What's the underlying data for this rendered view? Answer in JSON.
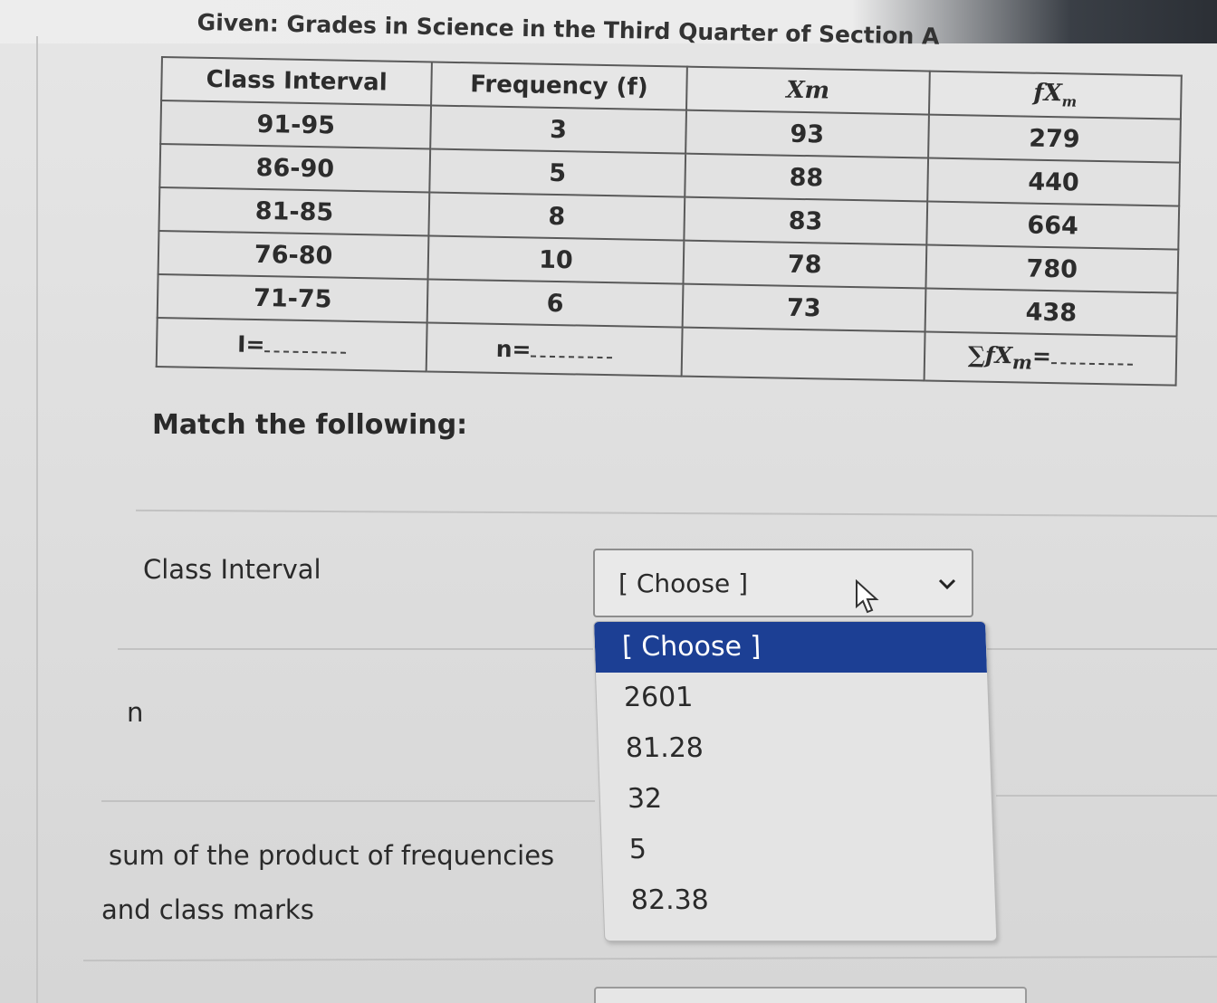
{
  "table": {
    "title": "Given: Grades in Science in the Third Quarter of Section A",
    "headers": {
      "class_interval": "Class Interval",
      "frequency": "Frequency (f)",
      "xm": "Xm",
      "fxm_f": "f",
      "fxm_x": "X",
      "fxm_sub": "m"
    },
    "rows": [
      {
        "interval": "91-95",
        "frequency": "3",
        "xm": "93",
        "fxm": "279"
      },
      {
        "interval": "86-90",
        "frequency": "5",
        "xm": "88",
        "fxm": "440"
      },
      {
        "interval": "81-85",
        "frequency": "8",
        "xm": "83",
        "fxm": "664"
      },
      {
        "interval": "76-80",
        "frequency": "10",
        "xm": "78",
        "fxm": "780"
      },
      {
        "interval": "71-75",
        "frequency": "6",
        "xm": "73",
        "fxm": "438"
      }
    ],
    "footer": {
      "i_label": "I=",
      "n_label": "n=",
      "sigma": "∑",
      "sum_f": "f",
      "sum_x": "X",
      "sum_sub": "m",
      "sum_eq": "="
    }
  },
  "match": {
    "heading": "Match the following:",
    "labels": {
      "class_interval": "Class Interval",
      "n": "n",
      "sum_line1": "sum of the product of frequencies",
      "sum_line2": "and class marks"
    },
    "select": {
      "value": "[ Choose ]",
      "options": [
        "[ Choose ]",
        "2601",
        "81.28",
        "32",
        "5",
        "82.38"
      ]
    }
  },
  "colors": {
    "selected_option": "#1c3f94"
  },
  "icons": {
    "chevron": "chevron-down-icon",
    "cursor": "mouse-pointer-icon"
  }
}
